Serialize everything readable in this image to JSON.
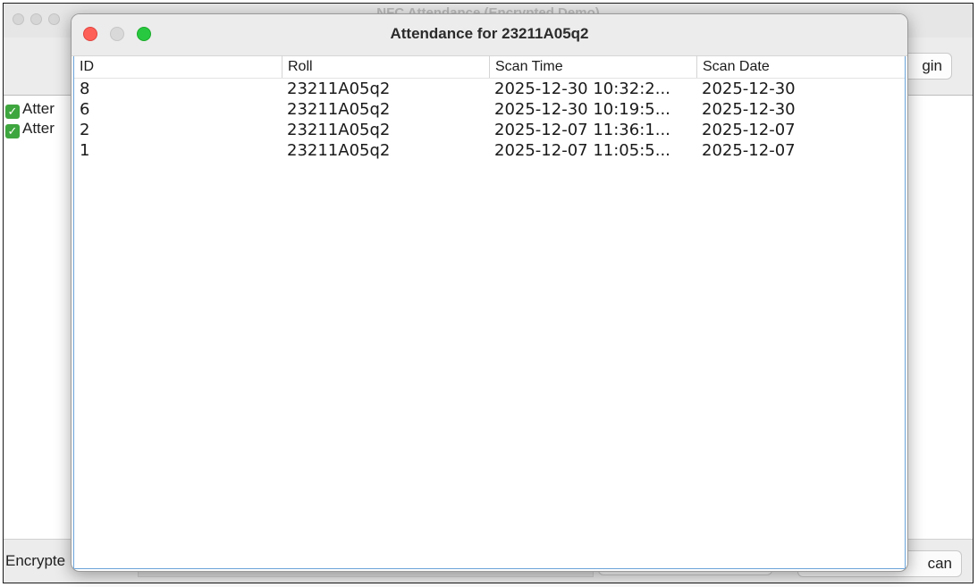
{
  "background_window": {
    "title": "NFC Attendance (Encrypted Demo)",
    "login_label": "gin",
    "list_items": [
      {
        "label": "Atter"
      },
      {
        "label": "Atter"
      }
    ],
    "status_label": "Encrypte",
    "scan_label": "can"
  },
  "dialog": {
    "title": "Attendance for 23211A05q2",
    "columns": [
      "ID",
      "Roll",
      "Scan Time",
      "Scan Date"
    ],
    "rows": [
      {
        "id": "8",
        "roll": "23211A05q2",
        "scan_time": "2025-12-30 10:32:2...",
        "scan_date": "2025-12-30"
      },
      {
        "id": "6",
        "roll": "23211A05q2",
        "scan_time": "2025-12-30 10:19:5...",
        "scan_date": "2025-12-30"
      },
      {
        "id": "2",
        "roll": "23211A05q2",
        "scan_time": "2025-12-07 11:36:1...",
        "scan_date": "2025-12-07"
      },
      {
        "id": "1",
        "roll": "23211A05q2",
        "scan_time": "2025-12-07 11:05:5...",
        "scan_date": "2025-12-07"
      }
    ]
  }
}
